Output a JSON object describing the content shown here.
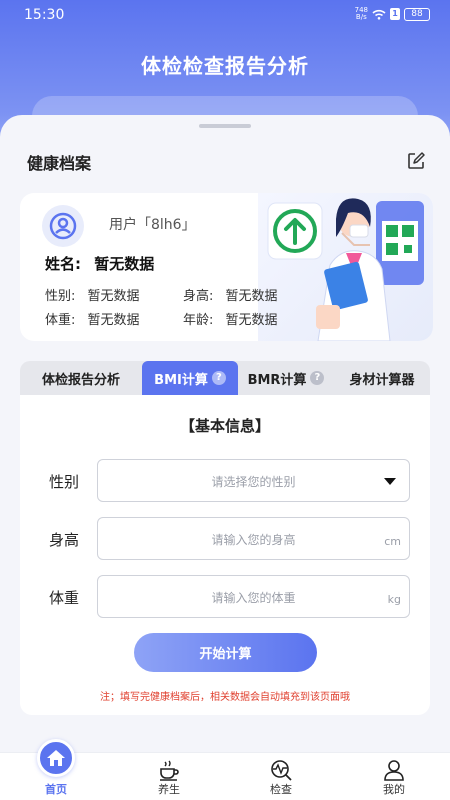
{
  "status_bar": {
    "time": "15:30",
    "net_speed_value": "748",
    "net_speed_unit": "B/s",
    "battery": "88"
  },
  "header": {
    "title": "体检检查报告分析"
  },
  "health_file": {
    "title": "健康档案",
    "user_label": "用户「8lh6」",
    "name_label": "姓名:",
    "name_value": "暂无数据",
    "gender_label": "性别:",
    "gender_value": "暂无数据",
    "height_label": "身高:",
    "height_value": "暂无数据",
    "weight_label": "体重:",
    "weight_value": "暂无数据",
    "age_label": "年龄:",
    "age_value": "暂无数据"
  },
  "tabs": [
    {
      "label": "体检报告分析",
      "active": false,
      "help": ""
    },
    {
      "label": "BMI计算",
      "active": true,
      "help": "?"
    },
    {
      "label": "BMR计算",
      "active": false,
      "help": "?"
    },
    {
      "label": "身材计算器",
      "active": false,
      "help": ""
    }
  ],
  "form": {
    "heading": "【基本信息】",
    "gender_label": "性别",
    "gender_placeholder": "请选择您的性别",
    "height_label": "身高",
    "height_placeholder": "请输入您的身高",
    "height_unit": "cm",
    "weight_label": "体重",
    "weight_placeholder": "请输入您的体重",
    "weight_unit": "kg",
    "submit_label": "开始计算",
    "note": "注；填写完健康档案后，相关数据会自动填充到该页面哦"
  },
  "nav": [
    {
      "label": "首页",
      "icon": "home-icon",
      "active": true
    },
    {
      "label": "养生",
      "icon": "teacup-icon",
      "active": false
    },
    {
      "label": "检查",
      "icon": "checkup-icon",
      "active": false
    },
    {
      "label": "我的",
      "icon": "person-icon",
      "active": false
    }
  ],
  "colors": {
    "primary": "#5b74ef",
    "warning": "#e0402f",
    "qr_green": "#22a857"
  }
}
